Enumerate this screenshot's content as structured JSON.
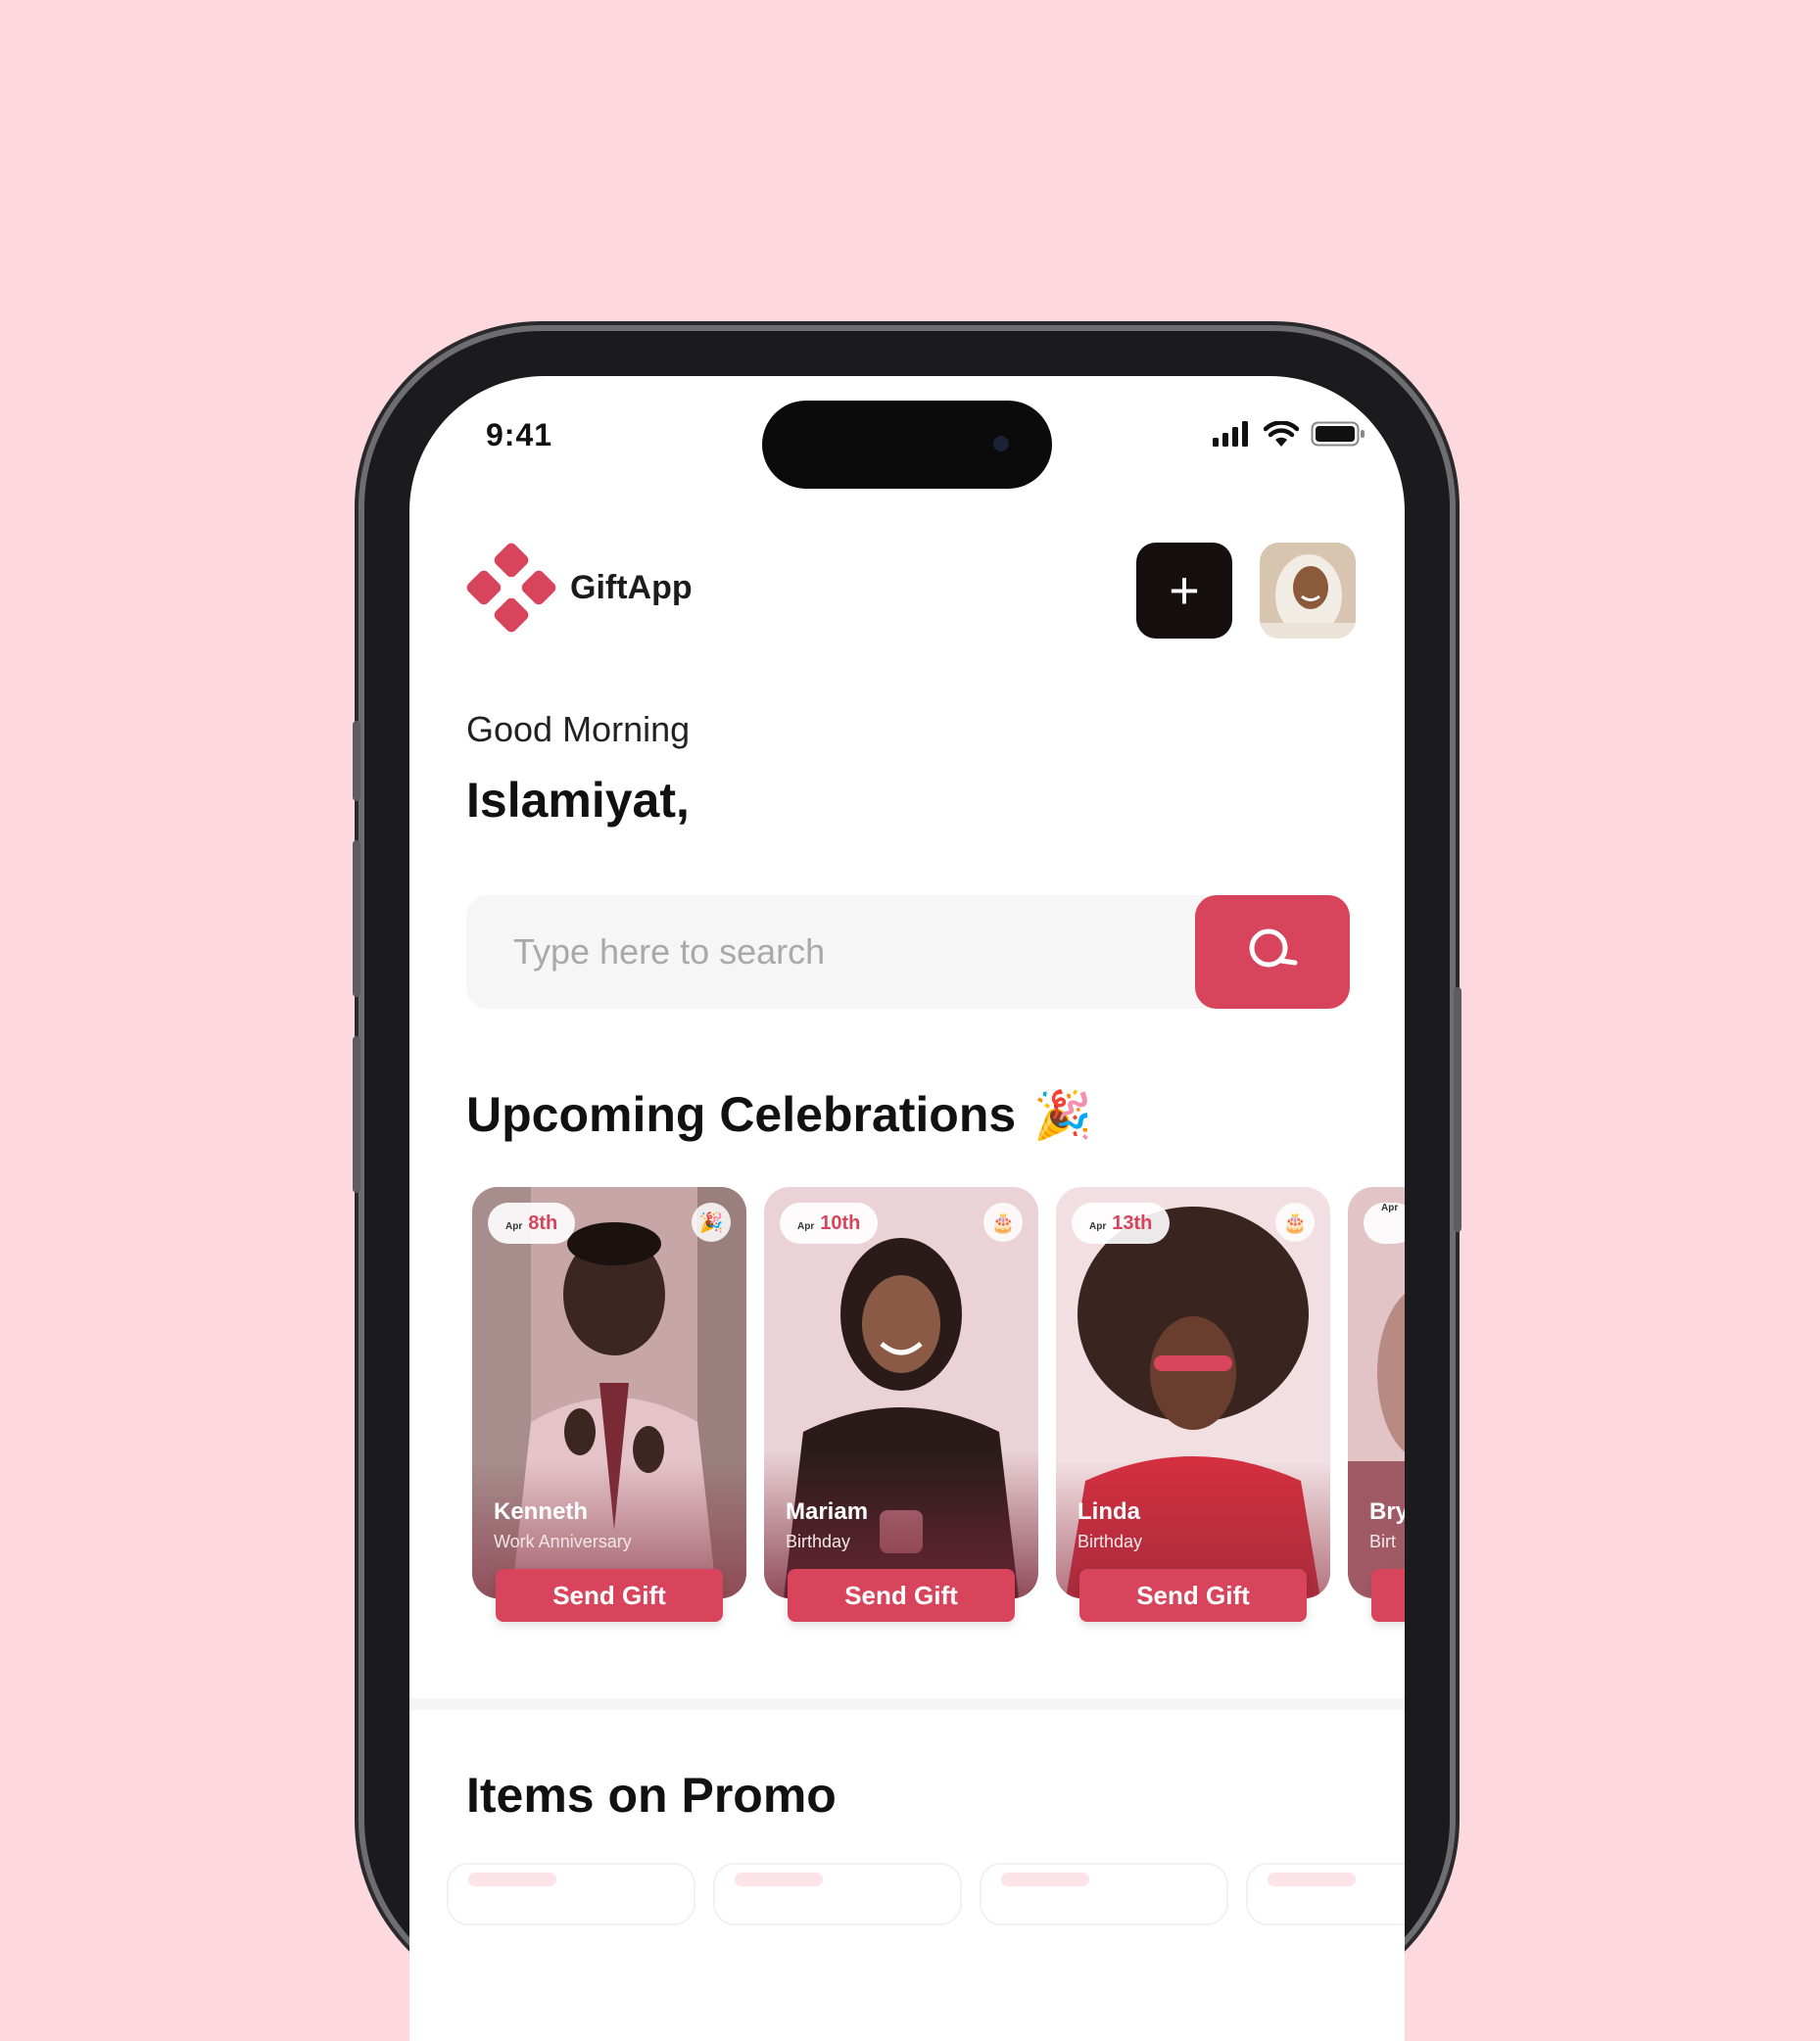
{
  "status_bar": {
    "time": "9:41"
  },
  "brand": {
    "name": "GiftApp"
  },
  "header": {
    "add_label": "+"
  },
  "greeting": {
    "salutation": "Good Morning",
    "name": "Islamiyat,"
  },
  "search": {
    "placeholder": "Type here to search"
  },
  "sections": {
    "celebrations_title": "Upcoming Celebrations",
    "celebrations_emoji": "🎉",
    "promo_title": "Items on Promo"
  },
  "celebrations": [
    {
      "month": "Apr",
      "day": "8th",
      "name": "Kenneth",
      "occasion": "Work Anniversary",
      "button": "Send Gift",
      "icon": "party-popper-icon"
    },
    {
      "month": "Apr",
      "day": "10th",
      "name": "Mariam",
      "occasion": "Birthday",
      "button": "Send Gift",
      "icon": "cake-icon"
    },
    {
      "month": "Apr",
      "day": "13th",
      "name": "Linda",
      "occasion": "Birthday",
      "button": "Send Gift",
      "icon": "cake-icon"
    },
    {
      "month": "Apr",
      "day": "",
      "name": "Bry",
      "occasion": "Birt",
      "button": "",
      "icon": ""
    }
  ],
  "colors": {
    "background": "#fdd9df",
    "accent": "#d9445d",
    "dark": "#160f10"
  }
}
